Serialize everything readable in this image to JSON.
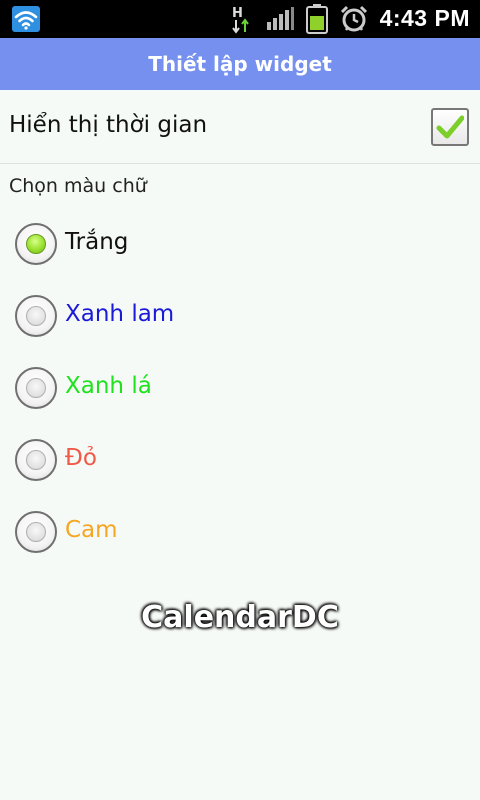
{
  "status_bar": {
    "time": "4:43 PM",
    "icons": [
      "wifi-icon",
      "hsdpa-icon",
      "signal-icon",
      "battery-icon",
      "alarm-icon"
    ],
    "network_label": "H"
  },
  "title": "Thiết lập widget",
  "show_time": {
    "label": "Hiển thị thời gian",
    "checked": true
  },
  "color_section": {
    "label": "Chọn màu chữ",
    "options": [
      {
        "label": "Trắng",
        "color": "#111111",
        "selected": true
      },
      {
        "label": "Xanh lam",
        "color": "#1a1ad8",
        "selected": false
      },
      {
        "label": "Xanh lá",
        "color": "#1ee21e",
        "selected": false
      },
      {
        "label": "Đỏ",
        "color": "#ef5a48",
        "selected": false
      },
      {
        "label": "Cam",
        "color": "#f5a623",
        "selected": false
      }
    ]
  },
  "watermark": "CalendarDC",
  "colors": {
    "title_bar": "#7590ee",
    "background": "#f6faf6",
    "status_bar": "#000000"
  }
}
